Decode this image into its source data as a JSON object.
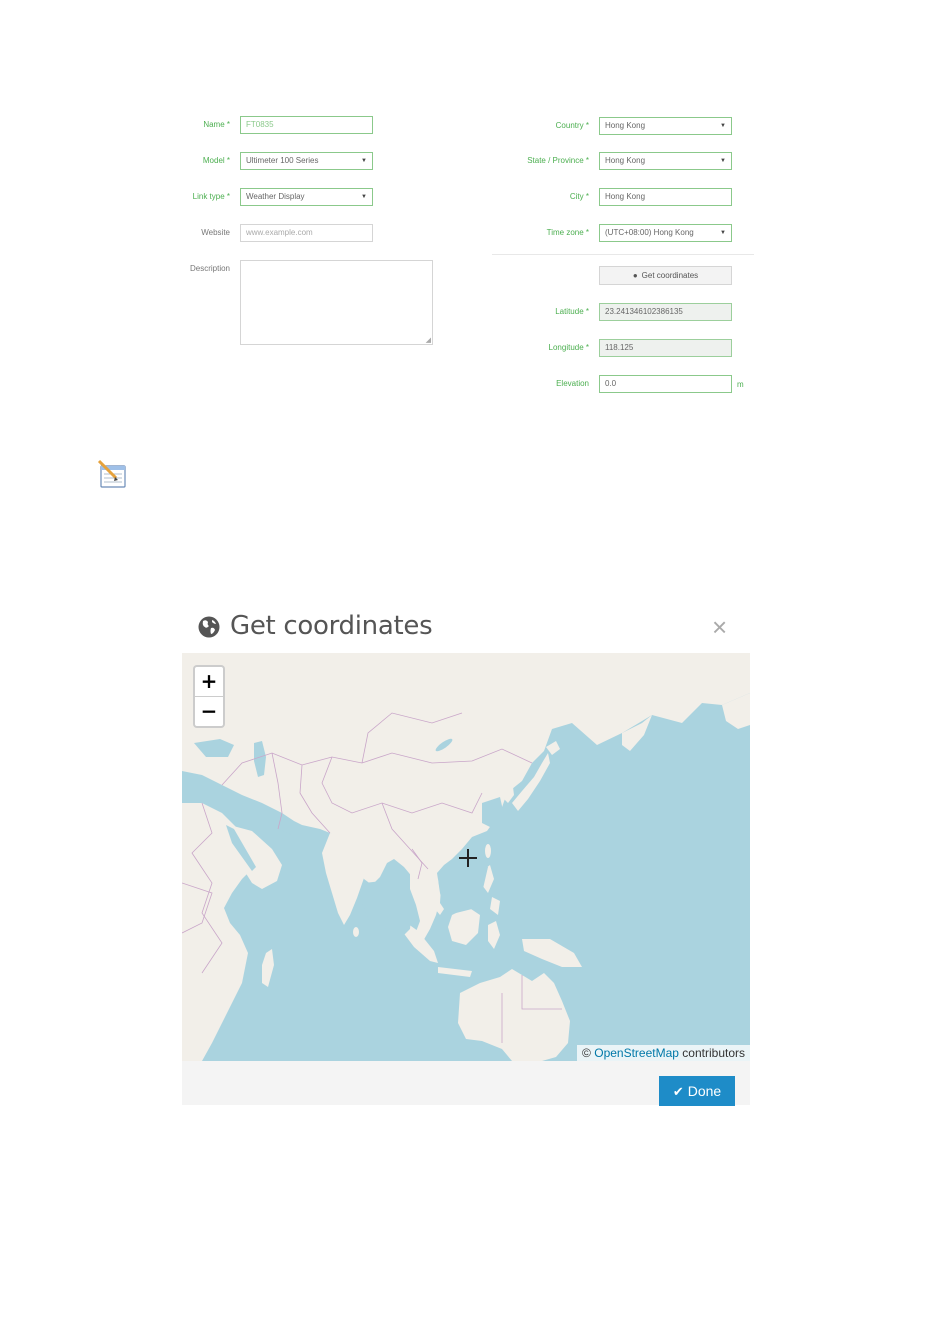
{
  "form": {
    "name": {
      "label": "Name *",
      "value": "FT0835"
    },
    "model": {
      "label": "Model *",
      "value": "Ultimeter 100 Series"
    },
    "link_type": {
      "label": "Link type *",
      "value": "Weather Display"
    },
    "website": {
      "label": "Website",
      "placeholder": "www.example.com"
    },
    "description": {
      "label": "Description"
    },
    "country": {
      "label": "Country *",
      "value": "Hong Kong"
    },
    "state": {
      "label": "State / Province *",
      "value": "Hong Kong"
    },
    "city": {
      "label": "City *",
      "value": "Hong Kong"
    },
    "time_zone": {
      "label": "Time zone *",
      "value": "(UTC+08:00) Hong Kong"
    },
    "get_coordinates_label": "Get coordinates",
    "latitude": {
      "label": "Latitude *",
      "value": "23.241346102386135"
    },
    "longitude": {
      "label": "Longitude *",
      "value": "118.125"
    },
    "elevation": {
      "label": "Elevation",
      "value": "0.0",
      "unit": "m"
    }
  },
  "dialog": {
    "title": "Get coordinates",
    "close_glyph": "×",
    "zoom_in": "+",
    "zoom_out": "−",
    "attribution": {
      "prefix": "©",
      "link": "OpenStreetMap",
      "suffix": "contributors"
    },
    "done_label": "Done",
    "colors": {
      "water": "#aad3df",
      "land": "#f2efe9",
      "border": "#c9a6c9",
      "primary": "#1e8cc8"
    }
  },
  "icons": [
    "globe-icon",
    "chevron-down-icon",
    "close-icon",
    "check-icon",
    "note-icon",
    "crosshair-icon"
  ]
}
